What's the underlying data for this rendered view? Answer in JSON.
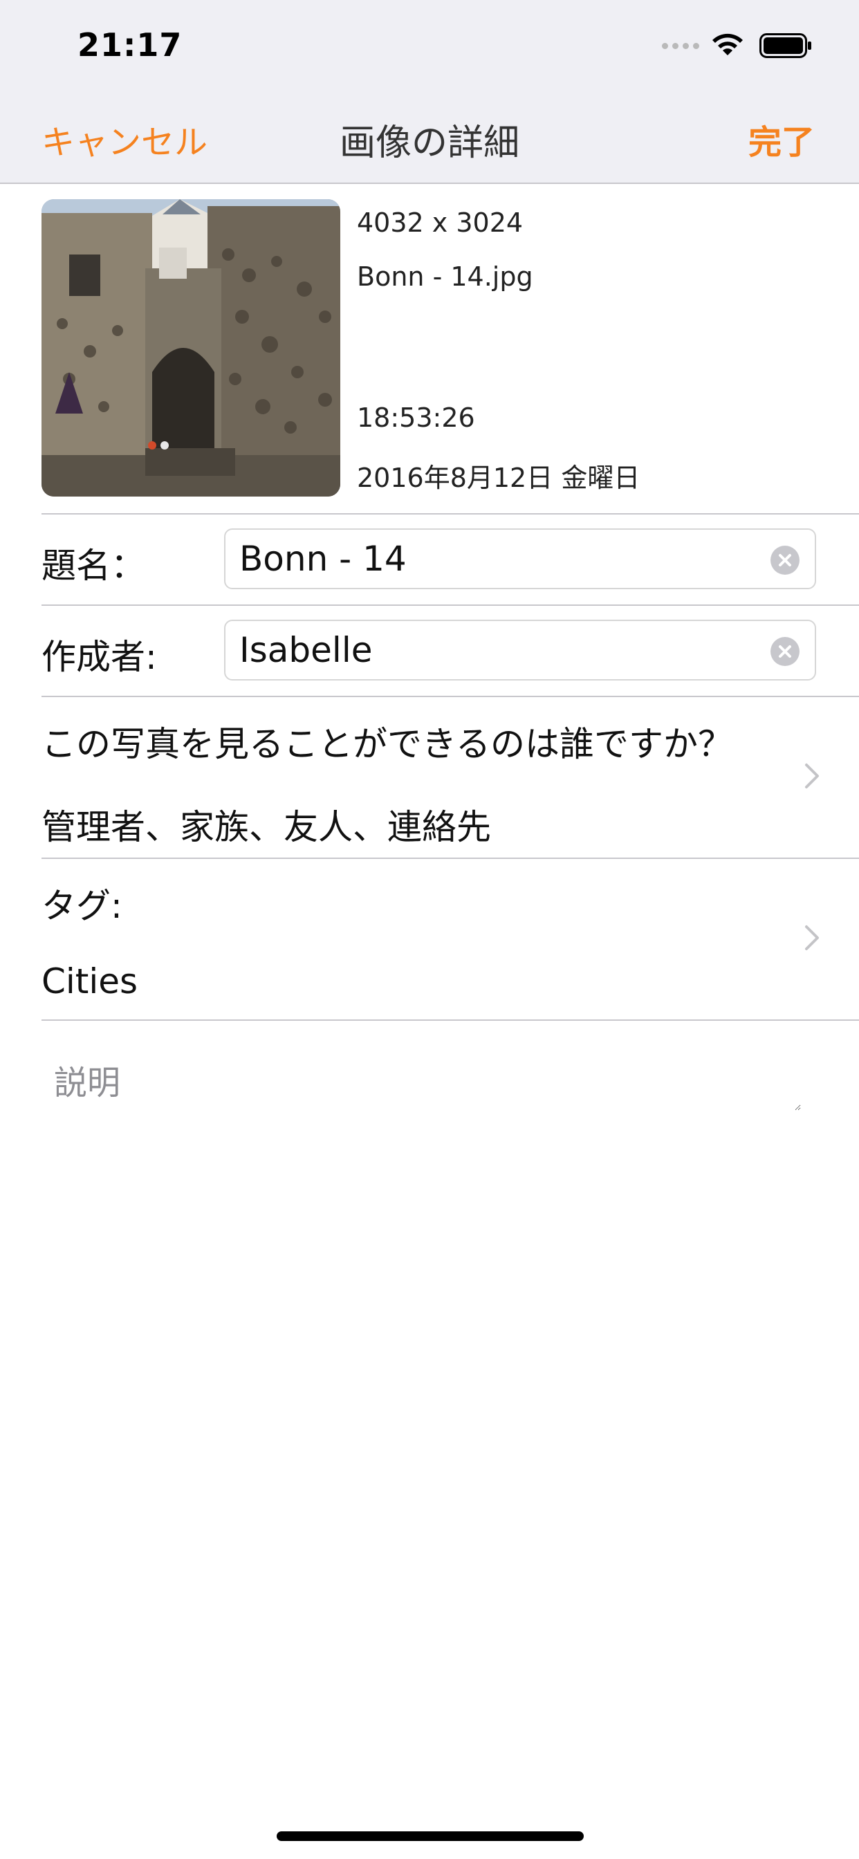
{
  "status_bar": {
    "time": "21:17"
  },
  "nav": {
    "cancel_label": "キャンセル",
    "title": "画像の詳細",
    "done_label": "完了",
    "accent_color": "#f5821f"
  },
  "image": {
    "dimensions": "4032 x 3024",
    "filename": "Bonn - 14.jpg",
    "time": "18:53:26",
    "date": "2016年8月12日 金曜日"
  },
  "form": {
    "title_label": "題名：",
    "title_value": "Bonn - 14",
    "author_label": "作成者:",
    "author_value": "Isabelle",
    "privacy_question": "この写真を見ることができるのは誰ですか？",
    "privacy_value": "管理者、家族、友人、連絡先",
    "tags_label": "タグ:",
    "tags_value": "Cities",
    "description_placeholder": "説明"
  },
  "icons": {
    "signal": "cellular-signal-icon",
    "wifi": "wifi-icon",
    "battery": "battery-icon",
    "clear": "clear-circle-icon",
    "chevron": "chevron-right-icon"
  }
}
